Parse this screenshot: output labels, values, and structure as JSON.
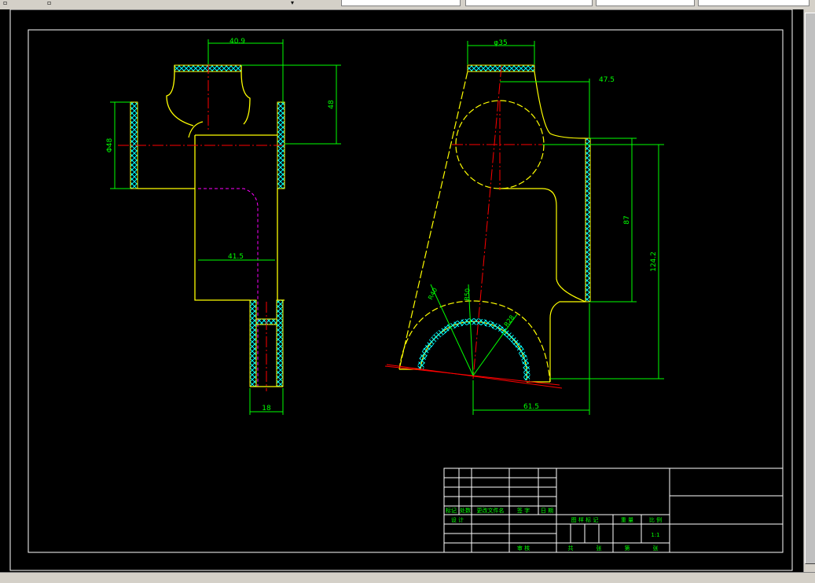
{
  "toolbar": {
    "icons": [
      "pan-icon",
      "zoom-icon",
      "layer-icon"
    ]
  },
  "drawing": {
    "dims": {
      "d1": "40.9",
      "d2": "48",
      "d3": "Φ48",
      "d4": "41.5",
      "d5": "18",
      "d6": "φ35",
      "d7": "47.5",
      "d8": "87",
      "d9": "124.2",
      "d10": "61.5",
      "r1": "R40",
      "r2": "R50",
      "r3": "R28"
    },
    "title_block": {
      "r1c1": "标记",
      "r1c2": "处数",
      "r1c3": "更改文件名",
      "r1c4": "签 字",
      "r1c5": "日 期",
      "design": "设 计",
      "audit": "审 核",
      "stage": "图 样 标 记",
      "weight": "重 量",
      "ratio": "比 例",
      "scale": "1:1",
      "total": "共",
      "sheet": "张",
      "page": "第",
      "page_sheet": "张"
    }
  },
  "colors": {
    "border": "#ffffff",
    "outline": "#ffff00",
    "dimension": "#00ff00",
    "centerline": "#ff0000",
    "hatch": "#00ffff",
    "hidden": "#ff00ff",
    "canvas": "#000000"
  }
}
